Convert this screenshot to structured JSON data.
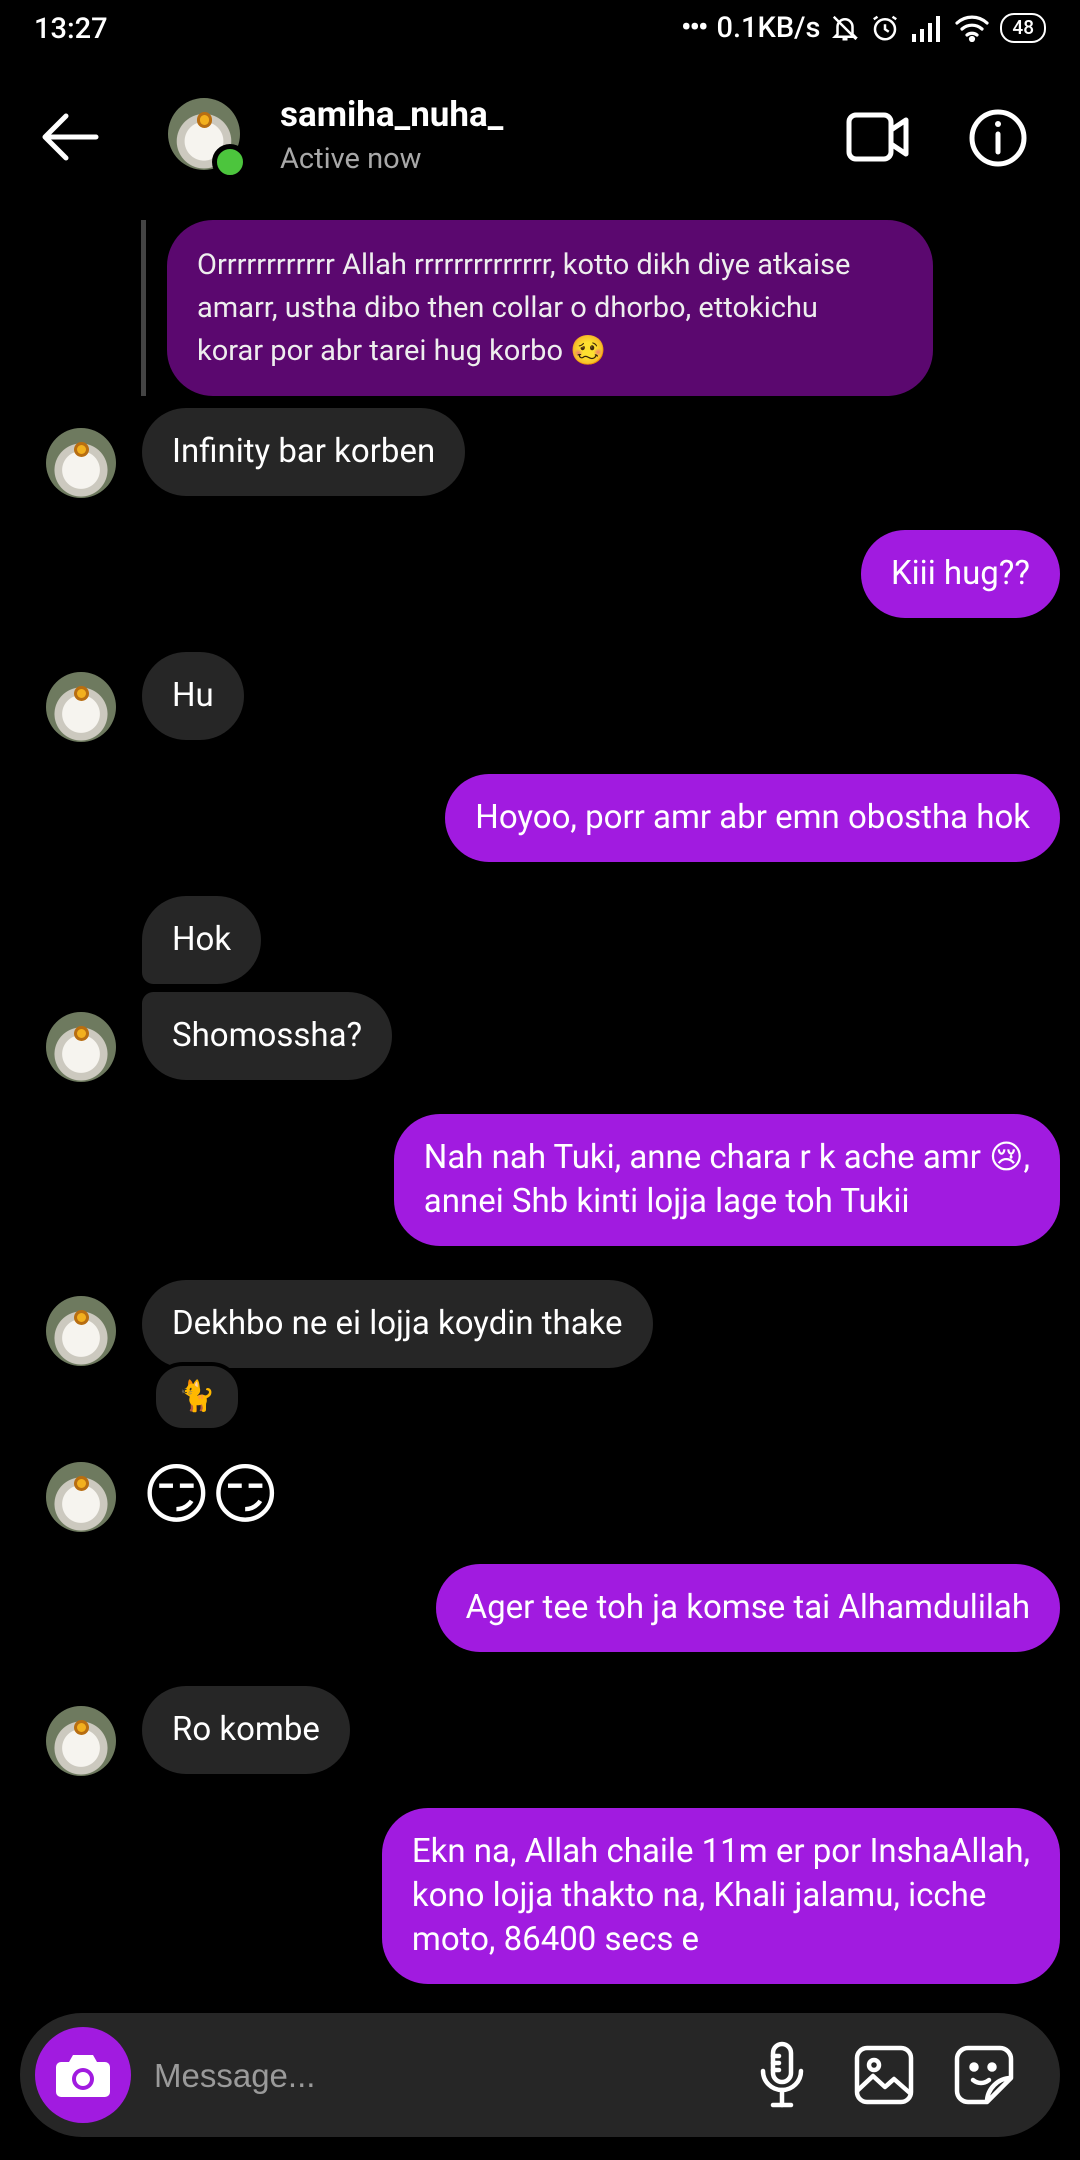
{
  "status_bar": {
    "time": "13:27",
    "network_speed": "0.1KB/s",
    "battery": "48"
  },
  "header": {
    "contact_name": "samiha_nuha_",
    "contact_status": "Active now",
    "icons": [
      "back-arrow-icon",
      "video-call-icon",
      "info-icon"
    ]
  },
  "thread": {
    "reply_quote": "Orrrrrrrrrrrr Allah rrrrrrrrrrrrrr, kotto dikh diye atkaise\namarr, ustha dibo then collar o dhorbo, ettokichu\nkorar por abr tarei hug korbo 🥴",
    "messages": [
      {
        "from": "them",
        "text": "Infinity bar korben"
      },
      {
        "from": "me",
        "text": "Kiii hug??"
      },
      {
        "from": "them",
        "text": "Hu"
      },
      {
        "from": "me",
        "text": "Hoyoo, porr amr abr emn obostha hok"
      },
      {
        "from": "them",
        "text": "Hok"
      },
      {
        "from": "them",
        "text": "Shomossha?"
      },
      {
        "from": "me",
        "text": "Nah nah Tuki, anne chara r k ache amr 😢,\nannei Shb kinti lojja lage toh Tukii"
      },
      {
        "from": "them",
        "text": "Dekhbo ne ei lojja koydin thake",
        "reaction": "🐈"
      },
      {
        "from": "them",
        "text": "😏😏"
      },
      {
        "from": "me",
        "text": "Ager tee toh ja komse tai Alhamdulilah"
      },
      {
        "from": "them",
        "text": "Ro kombe"
      },
      {
        "from": "me",
        "text": "Ekn na, Allah chaile 11m er por InshaAllah,\nkono lojja thakto na, Khali jalamu, icche\nmoto, 86400 secs e"
      }
    ]
  },
  "composer": {
    "placeholder": "Message...",
    "icons": [
      "camera-icon",
      "microphone-icon",
      "gallery-icon",
      "sticker-icon"
    ]
  },
  "colors": {
    "background": "#000000",
    "outgoing_bubble": "#a11be0",
    "incoming_bubble": "#262626",
    "reply_bubble": "#5b086f",
    "online_dot": "#4cc53d"
  }
}
